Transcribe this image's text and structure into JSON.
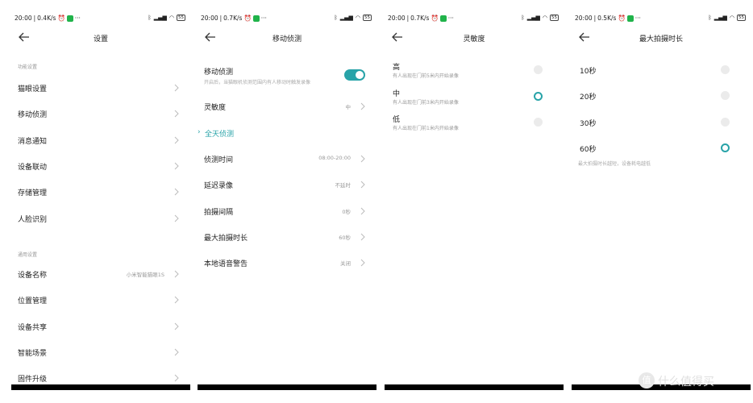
{
  "icons": {
    "back": "arrow-left-icon",
    "chevron": "chevron-right-icon",
    "status": [
      "alarm-icon",
      "wechat-icon",
      "bluetooth-icon",
      "signal-icon",
      "wifi-icon",
      "battery-icon"
    ]
  },
  "colors": {
    "accent": "#28a3a8",
    "radio_off": "#ebebeb",
    "text": "#222222",
    "muted": "#999999"
  },
  "screens": [
    {
      "status": {
        "time": "20:00",
        "speed": "0.4K/s",
        "more": "···",
        "battery": "55"
      },
      "title": "设置",
      "section_features": "功能设置",
      "features": [
        {
          "label": "猫眼设置",
          "value": ""
        },
        {
          "label": "移动侦测",
          "value": ""
        },
        {
          "label": "消息通知",
          "value": ""
        },
        {
          "label": "设备联动",
          "value": ""
        },
        {
          "label": "存储管理",
          "value": ""
        },
        {
          "label": "人脸识别",
          "value": ""
        }
      ],
      "section_general": "通用设置",
      "general": [
        {
          "label": "设备名称",
          "value": "小米智能猫眼1S"
        },
        {
          "label": "位置管理",
          "value": ""
        },
        {
          "label": "设备共享",
          "value": ""
        },
        {
          "label": "智能场景",
          "value": ""
        },
        {
          "label": "固件升级",
          "value": ""
        }
      ]
    },
    {
      "status": {
        "time": "20:00",
        "speed": "0.7K/s",
        "more": "···",
        "battery": "55"
      },
      "title": "移动侦测",
      "toggle": {
        "label": "移动侦测",
        "desc": "开启后，当猫眼机侦测范围内有人移动时触发录像",
        "on": true
      },
      "sensitivity": {
        "label": "灵敏度",
        "value": "中"
      },
      "link": "全天侦测",
      "items": [
        {
          "label": "侦测时间",
          "value": "08:00-20:00"
        },
        {
          "label": "延迟录像",
          "value": "不延时"
        },
        {
          "label": "拍摄间隔",
          "value": "0秒"
        },
        {
          "label": "最大拍摄时长",
          "value": "60秒"
        },
        {
          "label": "本地语音警告",
          "value": "关闭"
        }
      ]
    },
    {
      "status": {
        "time": "20:00",
        "speed": "0.7K/s",
        "more": "···",
        "battery": "55"
      },
      "title": "灵敏度",
      "options": [
        {
          "label": "高",
          "desc": "有人出现在门前5米内开始录像",
          "selected": false
        },
        {
          "label": "中",
          "desc": "有人出现在门前3米内开始录像",
          "selected": true
        },
        {
          "label": "低",
          "desc": "有人出现在门前1米内开始录像",
          "selected": false
        }
      ]
    },
    {
      "status": {
        "time": "20:00",
        "speed": "0.5K/s",
        "more": "···",
        "battery": "55"
      },
      "title": "最大拍摄时长",
      "options": [
        {
          "label": "10秒",
          "selected": false
        },
        {
          "label": "20秒",
          "selected": false
        },
        {
          "label": "30秒",
          "selected": false
        },
        {
          "label": "60秒",
          "selected": true
        }
      ],
      "note": "最大拍摄时长越短，设备耗电越低"
    }
  ],
  "watermark": {
    "badge": "值",
    "text": "什么值得买"
  }
}
